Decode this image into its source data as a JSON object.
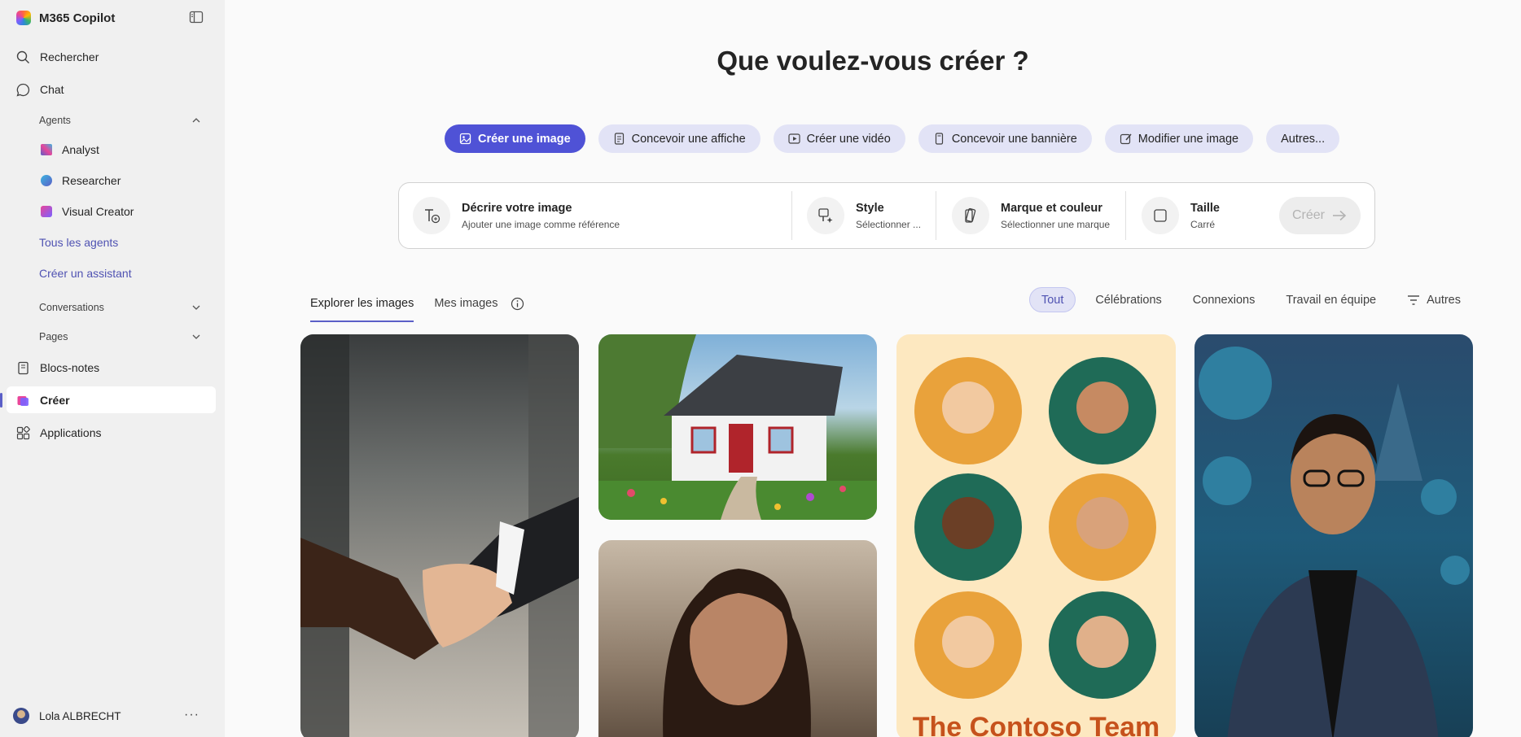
{
  "app": {
    "title": "M365 Copilot"
  },
  "sidebar": {
    "search": "Rechercher",
    "chat": "Chat",
    "agents_label": "Agents",
    "agents": [
      "Analyst",
      "Researcher",
      "Visual Creator"
    ],
    "all_agents": "Tous les agents",
    "create_assistant": "Créer un assistant",
    "conversations": "Conversations",
    "pages": "Pages",
    "notebooks": "Blocs-notes",
    "create": "Créer",
    "apps": "Applications"
  },
  "user": {
    "name": "Lola ALBRECHT"
  },
  "main": {
    "heading": "Que voulez-vous créer ?",
    "pills": [
      "Créer une image",
      "Concevoir une affiche",
      "Créer une vidéo",
      "Concevoir une bannière",
      "Modifier une image",
      "Autres..."
    ],
    "composer": {
      "describe_title": "Décrire votre image",
      "describe_sub": "Ajouter une image comme référence",
      "style_title": "Style",
      "style_sub": "Sélectionner ...",
      "brand_title": "Marque et couleur",
      "brand_sub": "Sélectionner une marque",
      "size_title": "Taille",
      "size_sub": "Carré",
      "create_label": "Créer"
    },
    "tabs": [
      "Explorer les images",
      "Mes images"
    ],
    "filters": [
      "Tout",
      "Célébrations",
      "Connexions",
      "Travail en équipe",
      "Autres"
    ]
  },
  "gallery": {
    "team_caption": "The Contoso Team"
  },
  "colors": {
    "accent": "#4f52d6",
    "pill_bg": "#e2e3f6",
    "link": "#4f52b2"
  }
}
